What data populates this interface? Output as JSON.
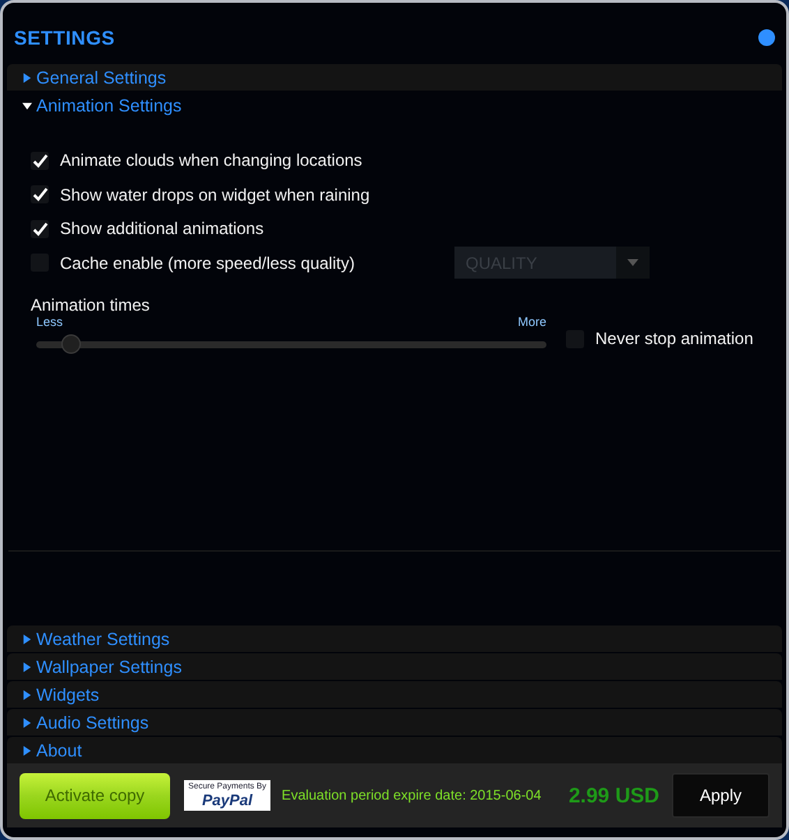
{
  "window": {
    "title": "SETTINGS",
    "status_dot": {
      "color": "#2f8fff"
    }
  },
  "sections_top": [
    {
      "label": "General Settings",
      "expanded": false
    },
    {
      "label": "Animation Settings",
      "expanded": true
    }
  ],
  "animation": {
    "options": [
      {
        "label": "Animate clouds when changing locations",
        "checked": true
      },
      {
        "label": "Show water drops on widget when raining",
        "checked": true
      },
      {
        "label": "Show additional animations",
        "checked": true
      },
      {
        "label": "Cache enable (more speed/less quality)",
        "checked": false
      }
    ],
    "quality_select": {
      "value": "QUALITY",
      "disabled": true
    },
    "times": {
      "label": "Animation times",
      "min_label": "Less",
      "max_label": "More",
      "level": 0.05
    },
    "never_stop": {
      "label": "Never stop animation",
      "checked": false
    }
  },
  "sections_bottom": [
    {
      "label": "Weather Settings",
      "expanded": false
    },
    {
      "label": "Wallpaper Settings",
      "expanded": false
    },
    {
      "label": "Widgets",
      "expanded": false
    },
    {
      "label": "Audio Settings",
      "expanded": false
    },
    {
      "label": "About",
      "expanded": false
    }
  ],
  "footer": {
    "activate": "Activate copy",
    "paypal": {
      "top": "Secure Payments By",
      "brand": "PayPal"
    },
    "evaluation": "Evaluation period expire date: 2015-06-04",
    "price": "2.99 USD",
    "apply": "Apply"
  }
}
